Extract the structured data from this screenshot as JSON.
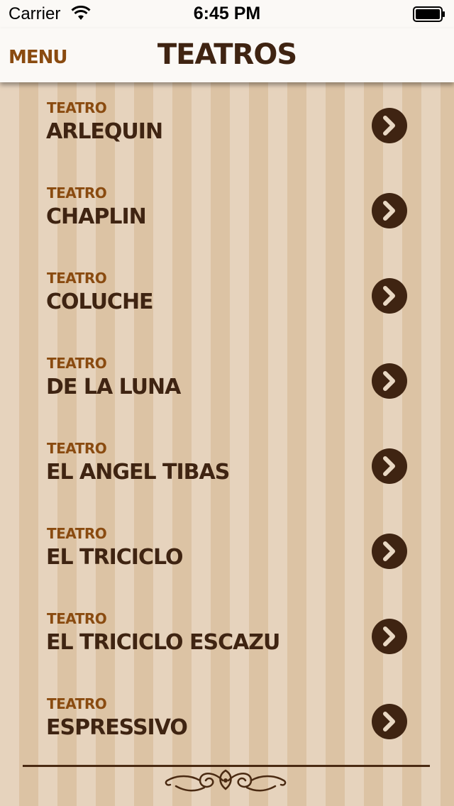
{
  "status_bar": {
    "carrier": "Carrier",
    "time": "6:45 PM",
    "icons": [
      "wifi-icon",
      "battery-icon"
    ]
  },
  "nav": {
    "menu_label": "MENU",
    "title": "TEATROS"
  },
  "theaters": [
    {
      "kicker": "TEATRO",
      "name": "ARLEQUIN"
    },
    {
      "kicker": "TEATRO",
      "name": "CHAPLIN"
    },
    {
      "kicker": "TEATRO",
      "name": "COLUCHE"
    },
    {
      "kicker": "TEATRO",
      "name": "DE LA LUNA"
    },
    {
      "kicker": "TEATRO",
      "name": "EL ANGEL TIBAS"
    },
    {
      "kicker": "TEATRO",
      "name": "EL TRICICLO"
    },
    {
      "kicker": "TEATRO",
      "name": "EL TRICICLO ESCAZU"
    },
    {
      "kicker": "TEATRO",
      "name": "ESPRESSIVO"
    }
  ],
  "row_icon": "chevron-right-circle-icon",
  "footer_icon": "ornament-flourish-icon",
  "colors": {
    "accent": "#8a4b10",
    "dark_brown": "#3f2412",
    "stripe_light": "#e6d3bd",
    "stripe_dark": "#dcc3a4"
  }
}
